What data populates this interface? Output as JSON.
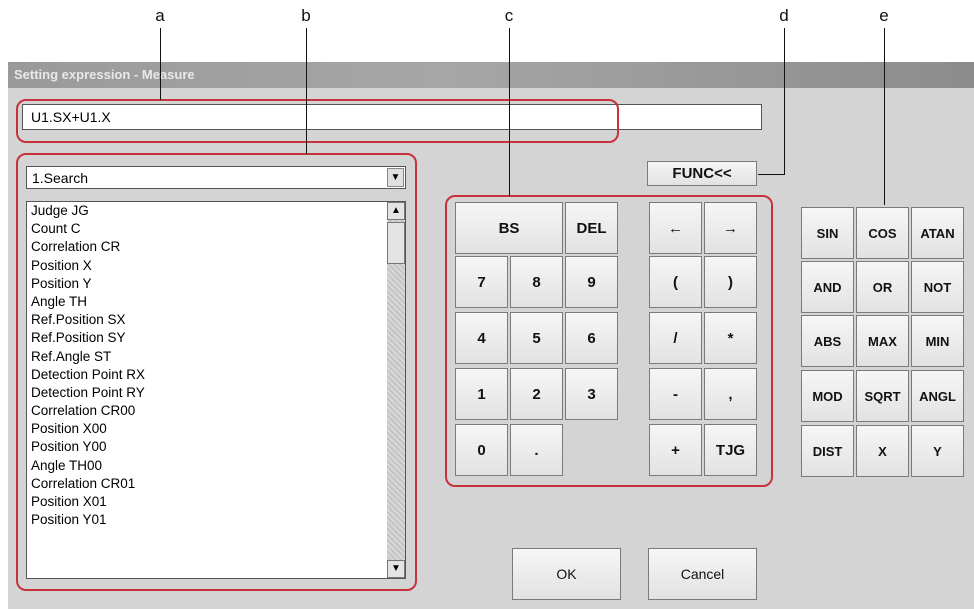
{
  "callouts": {
    "a": "a",
    "b": "b",
    "c": "c",
    "d": "d",
    "e": "e"
  },
  "window": {
    "title": "Setting expression - Measure"
  },
  "expression": {
    "value": "U1.SX+U1.X"
  },
  "unit_select": {
    "selected": "1.Search"
  },
  "items": [
    "Judge JG",
    "Count C",
    "Correlation CR",
    "Position X",
    "Position Y",
    "Angle TH",
    "Ref.Position SX",
    "Ref.Position SY",
    "Ref.Angle ST",
    "Detection Point RX",
    "Detection Point RY",
    "Correlation CR00",
    "Position X00",
    "Position Y00",
    "Angle TH00",
    "Correlation CR01",
    "Position X01",
    "Position Y01"
  ],
  "keys": {
    "bs": "BS",
    "del": "DEL",
    "left": "←",
    "right": "→",
    "n7": "7",
    "n8": "8",
    "n9": "9",
    "lparen": "(",
    "rparen": ")",
    "n4": "4",
    "n5": "5",
    "n6": "6",
    "div": "/",
    "mul": "*",
    "n1": "1",
    "n2": "2",
    "n3": "3",
    "minus": "-",
    "comma": ",",
    "n0": "0",
    "dot": ".",
    "plus": "+",
    "tjg": "TJG"
  },
  "func_toggle": "FUNC<<",
  "funcs": {
    "sin": "SIN",
    "cos": "COS",
    "atan": "ATAN",
    "and": "AND",
    "or": "OR",
    "not": "NOT",
    "abs": "ABS",
    "max": "MAX",
    "min": "MIN",
    "mod": "MOD",
    "sqrt": "SQRT",
    "angl": "ANGL",
    "dist": "DIST",
    "x": "X",
    "y": "Y"
  },
  "actions": {
    "ok": "OK",
    "cancel": "Cancel"
  }
}
